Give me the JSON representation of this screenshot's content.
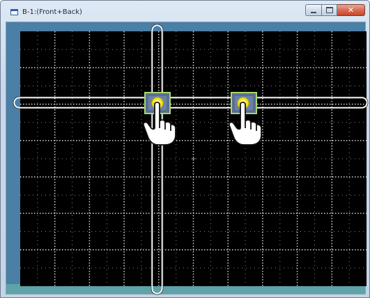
{
  "window": {
    "title": "B-1:(Front+Back)",
    "buttons": {
      "minimize_icon": "minimize-icon",
      "maximize_icon": "maximize-icon",
      "close_icon": "close-icon",
      "close_glyph": "✕"
    }
  },
  "colors": {
    "canvas_background": "#000000",
    "grid_major": "#d8d8d8",
    "grid_minor": "#8a8a8a",
    "client_frame": "#4a7fa6",
    "bottom_strip": "#5ea3a7",
    "touch_point": "#f5e21a",
    "touch_box": "#5a6d8f",
    "touch_box_border": "#a6d86e",
    "scan_line": "#ffffff"
  },
  "canvas": {
    "grid": {
      "major_columns": 10,
      "major_rows": 7,
      "center_marker": true
    },
    "touch_points": [
      {
        "id": "touch-point-1",
        "icon": "finger-pointer-icon"
      },
      {
        "id": "touch-point-2",
        "icon": "finger-pointer-icon"
      }
    ]
  }
}
